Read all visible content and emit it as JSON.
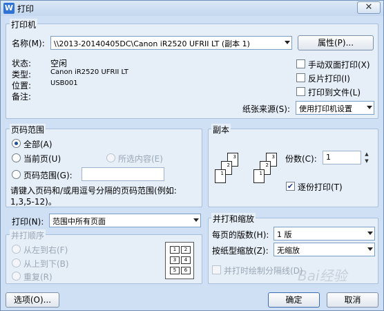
{
  "window": {
    "title": "打印",
    "icon_letter": "W",
    "close_glyph": "✕"
  },
  "printer": {
    "group_label": "打印机",
    "name_label": "名称(M):",
    "name_value": "\\\\2013-20140405DC\\Canon iR2520 UFRII LT (副本 1)",
    "properties_button": "属性(P)...",
    "status_label": "状态:",
    "status_value": "空闲",
    "type_label": "类型:",
    "type_value": "Canon iR2520 UFRII LT",
    "location_label": "位置:",
    "location_value": "USB001",
    "comment_label": "备注:",
    "manual_duplex_label": "手动双面打印(X)",
    "reverse_print_label": "反片打印(I)",
    "print_to_file_label": "打印到文件(L)",
    "paper_source_label": "纸张来源(S):",
    "paper_source_value": "使用打印机设置"
  },
  "page_range": {
    "group_label": "页码范围",
    "all_label": "全部(A)",
    "current_label": "当前页(U)",
    "selection_label": "所选内容(E)",
    "range_label": "页码范围(G):",
    "range_value": "",
    "hint_line1": "请键入页码和/或用逗号分隔的页码范围(例如:",
    "hint_line2": "1,3,5-12)。"
  },
  "copies": {
    "group_label": "副本",
    "count_label": "份数(C):",
    "count_value": "1",
    "collate_label": "逐份打印(T)",
    "collate_checked": true,
    "spin_up": "▲",
    "spin_down": "▼",
    "page_nums": [
      "3",
      "2",
      "1",
      "3",
      "2",
      "1"
    ]
  },
  "print_what": {
    "label": "打印(N):",
    "value": "范围中所有页面"
  },
  "order": {
    "group_label": "并打顺序",
    "ltr_label": "从左到右(F)",
    "ttb_label": "从上到下(B)",
    "repeat_label": "重复(R)",
    "grid": [
      "1",
      "2",
      "3",
      "4",
      "5",
      "6"
    ]
  },
  "zoom": {
    "group_label": "并打和缩放",
    "pages_per_sheet_label": "每页的版数(H):",
    "pages_per_sheet_value": "1 版",
    "scale_label": "按纸型缩放(Z):",
    "scale_value": "无缩放",
    "draw_borders_label": "并打时绘制分隔线(D)"
  },
  "footer": {
    "options_button": "选项(O)...",
    "ok_button": "确定",
    "cancel_button": "取消"
  },
  "watermark": "Bai经验"
}
